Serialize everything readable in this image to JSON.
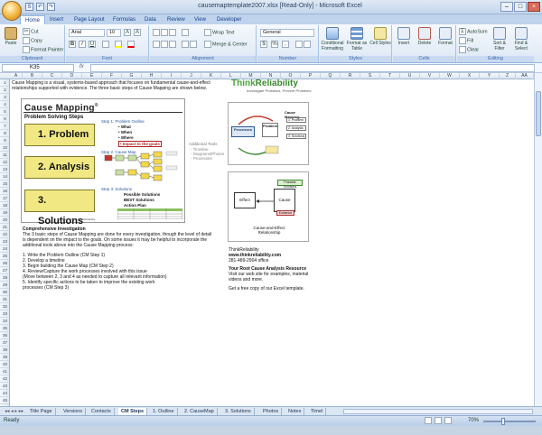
{
  "window": {
    "title": "causemaptemplate2007.xlsx [Read-Only] - Microsoft Excel",
    "controls": [
      "–",
      "□",
      "×"
    ]
  },
  "quick_access": [
    "S",
    "↶",
    "↷"
  ],
  "ribbon_tabs": [
    "Home",
    "Insert",
    "Page Layout",
    "Formulas",
    "Data",
    "Review",
    "View",
    "Developer"
  ],
  "active_tab": "Home",
  "clipboard": {
    "paste": "Paste",
    "cut": "Cut",
    "copy": "Copy",
    "format_painter": "Format Painter",
    "group": "Clipboard"
  },
  "font": {
    "name": "Arial",
    "size": "10",
    "grow": "A",
    "shrink": "A",
    "bold": "B",
    "italic": "I",
    "underline": "U",
    "group": "Font"
  },
  "alignment": {
    "wrap": "Wrap Text",
    "merge": "Merge & Center",
    "group": "Alignment"
  },
  "number": {
    "format": "General",
    "currency": "$",
    "percent": "%",
    "comma": ",",
    "group": "Number"
  },
  "styles": {
    "conditional": "Conditional Formatting",
    "table": "Format as Table",
    "cell": "Cell Styles",
    "group": "Styles"
  },
  "cells": {
    "insert": "Insert",
    "delete": "Delete",
    "format": "Format",
    "group": "Cells"
  },
  "editing": {
    "autosum": "AutoSum",
    "fill": "Fill",
    "clear": "Clear",
    "sort": "Sort & Filter",
    "find": "Find & Select",
    "group": "Editing"
  },
  "formula_bar": {
    "name_box": "K35",
    "fx": "fx",
    "value": ""
  },
  "columns": [
    "A",
    "B",
    "C",
    "D",
    "E",
    "F",
    "G",
    "H",
    "I",
    "J",
    "K",
    "L",
    "M",
    "N",
    "O",
    "P",
    "Q",
    "R",
    "S",
    "T",
    "U",
    "V",
    "W",
    "X",
    "Y",
    "Z",
    "AA"
  ],
  "sheet": {
    "intro1": "Cause Mapping is a visual, systems-based approach that focuses on fundamental cause-and-effect",
    "intro2": "relationships supported with evidence.  The three basic steps of Cause Mapping are shown below.",
    "cm_title": "Cause Mapping",
    "cm_reg": "®",
    "pss": "Problem Solving Steps",
    "steps": [
      "1.  Problem",
      "2.  Analysis",
      "3.  Solutions"
    ],
    "step1_head": "Step 1: Problem Outline",
    "step1_items": [
      "• What",
      "• When",
      "• Where",
      "• Impact to the goals"
    ],
    "step2_head": "Step 2: Cause Map",
    "step3_head": "Step 3: Solutions",
    "step3_items": [
      "Possible Solutions",
      "BEST Solutions",
      "Action Plan"
    ],
    "additional": "Additional Tools",
    "additional_items": [
      "- Timeline",
      "- Diagrams/Photos",
      "- Processes"
    ],
    "copyright": "Copyright 2008 ThinkReliability",
    "comp_head": "Comprehensive Investigation",
    "comp1": "The 3 basic steps of Cause Mapping are done for every investigation, though the level of detail",
    "comp2": "is dependent on the impact to the goals.  On some issues it may be helpful to incorporate the",
    "comp3": "additional tools above into the Cause Mapping process:",
    "list": [
      "1. Write the Problem Outline (CM Step 1)",
      "2. Develop a timeline",
      "3. Begin building the Cause Map (CM Step 2)",
      "4. Review/Capture the work processes involved with this issue",
      "    (Move between 2, 3 and 4 as needed to capture all relevant information)",
      "5. Identify specific actions to be taken to improve the existing work",
      "    processes (CM Step 3)"
    ],
    "tr_logo_a": "Think",
    "tr_logo_b": "Reliability",
    "tr_tag": "Investigate Problems, Prevent Problems",
    "d1_processes": "Processes",
    "d1_problem": "Problem",
    "d1_cause_mapping": "Cause Mapping",
    "d1_items": [
      "1. Problem",
      "2. Analysis",
      "3. Solutions"
    ],
    "d2_effect": "Effect",
    "d2_cause": "Cause",
    "d2_possible": "Possible Solutions",
    "d2_evidence": "Evidence",
    "d2_caption": "Cause-and-Effect Relationship",
    "contact_name": "ThinkReliability",
    "contact_url": "www.thinkreliability.com",
    "contact_phone": "281-489-2904  office",
    "rca_head": "Your Root Cause Analysis Resource",
    "rca1": "Visit our web site for examples, material",
    "rca2": "videos and more.",
    "free_copy": "Get a free copy of our Excel template."
  },
  "sheet_tabs": [
    "Title Page",
    "Versions",
    "Contacts",
    "CM Steps",
    "1. Outline",
    "2. CauseMap",
    "3. Solutions",
    "Photos",
    "Notes",
    "Timel"
  ],
  "active_sheet": "CM Steps",
  "status": {
    "ready": "Ready",
    "zoom": "70%"
  },
  "colors": {
    "step_fill": "#f1e884",
    "logo_green": "#3c8a32",
    "ribbon_blue": "#15428b"
  }
}
